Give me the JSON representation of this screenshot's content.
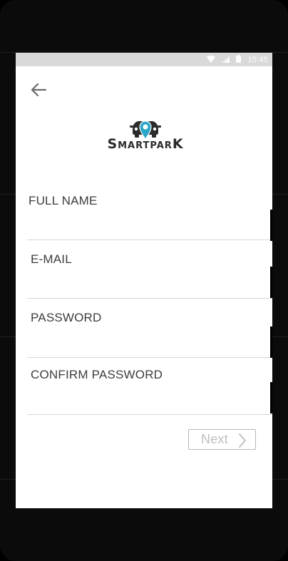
{
  "status_bar": {
    "time": "15:45",
    "icons": [
      "wifi-icon",
      "signal-icon",
      "battery-icon"
    ]
  },
  "header": {
    "back_icon": "arrow-left-icon"
  },
  "logo": {
    "text": "SmartparK",
    "icon": "location-pin-car-icon",
    "accent_color": "#2aa7c8"
  },
  "form": {
    "fields": [
      {
        "label": "FULL NAME",
        "value": "",
        "type": "text"
      },
      {
        "label": "E-MAIL",
        "value": "",
        "type": "email"
      },
      {
        "label": "PASSWORD",
        "value": "",
        "type": "password"
      },
      {
        "label": "CONFIRM PASSWORD",
        "value": "",
        "type": "password"
      }
    ],
    "next_label": "Next",
    "next_icon": "chevron-right-icon"
  },
  "colors": {
    "screen_bg": "#ffffff",
    "status_bar_bg": "#d9d9d9",
    "device_frame": "#0b0b0b",
    "label_text": "#3c3c3c",
    "divider": "#d6d6d6",
    "button_disabled_text": "#bdbdbd"
  }
}
